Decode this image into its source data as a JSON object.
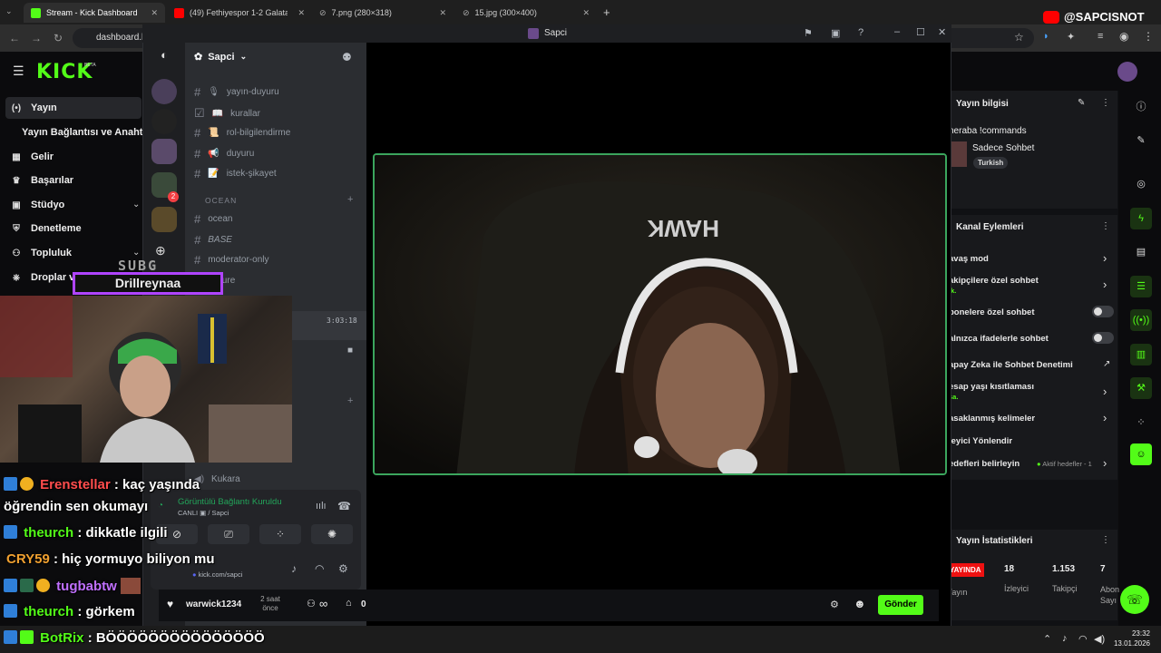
{
  "browser": {
    "tabs": [
      {
        "title": "Stream - Kick Dashboard",
        "icon": "kick-icon",
        "active": true
      },
      {
        "title": "(49) Fethiyespor 1-2 Galatasaray",
        "icon": "youtube-icon"
      },
      {
        "title": "7.png (280×318)",
        "icon": "globe-icon"
      },
      {
        "title": "15.jpg (300×400)",
        "icon": "globe-icon"
      }
    ],
    "url": "dashboard.ki",
    "new_tab": "+"
  },
  "watermark": "@SAPCISNOT",
  "kick": {
    "logo": "KICK",
    "beta": "BETA",
    "sidebar": [
      {
        "label": "Yayın",
        "icon": "broadcast-icon"
      },
      {
        "label": "Yayın Bağlantısı ve Anahta",
        "icon": ""
      },
      {
        "label": "Gelir",
        "icon": "chart-icon"
      },
      {
        "label": "Başarılar",
        "icon": "trophy-icon"
      },
      {
        "label": "Stüdyo",
        "icon": "video-icon"
      },
      {
        "label": "Denetleme",
        "icon": "shield-icon"
      },
      {
        "label": "Topluluk",
        "icon": "people-icon"
      },
      {
        "label": "Droplar ve ödüller",
        "icon": "gift-icon"
      }
    ],
    "stream_info": {
      "title": "Yayın bilgisi",
      "stream_title": "neraba !commands",
      "category": "Sadece Sohbet",
      "tag": "Turkish"
    },
    "channel_actions": {
      "title": "Kanal Eylemleri",
      "items": [
        {
          "label": "avaş mod",
          "control": "chevron"
        },
        {
          "label": "akipçilere özel sohbet",
          "sub": "ik.",
          "control": "chevron"
        },
        {
          "label": "bonelere özel sohbet",
          "control": "toggle"
        },
        {
          "label": "alnızca ifadelerle sohbet",
          "control": "toggle"
        },
        {
          "label": "apay Zeka ile Sohbet Denetimi",
          "control": "external"
        },
        {
          "label": "esap yaşı kısıtlaması",
          "sub": "sa.",
          "control": "chevron"
        },
        {
          "label": "asaklanmış kelimeler",
          "control": "chevron"
        },
        {
          "label": "leyici Yönlendir",
          "control": ""
        },
        {
          "label": "edefleri belirleyin",
          "sub_right": "Aktif hedefler - 1",
          "control": "chevron"
        }
      ]
    },
    "stats": {
      "title": "Yayın İstatistikleri",
      "live_badge": "YAYINDA",
      "live_label": "Yayın",
      "viewers": "18",
      "viewers_label": "İzleyici",
      "followers": "1.153",
      "followers_label": "Takipçi",
      "subs": "7",
      "subs_label": "Abon Sayı"
    },
    "bottom": {
      "user": "warwick1234",
      "time": "2 saat önce",
      "infinity": "∞",
      "count": "0",
      "send": "Gönder"
    }
  },
  "discord": {
    "window_title": "Sapci",
    "server_name": "Sapci",
    "channels": [
      {
        "name": "yayın-duyuru",
        "emoji": "🎙"
      },
      {
        "name": "kurallar",
        "emoji": "📖"
      },
      {
        "name": "rol-bilgilendirme",
        "emoji": "📜"
      },
      {
        "name": "duyuru",
        "emoji": "📢"
      },
      {
        "name": "istek-şikayet",
        "emoji": "📝"
      }
    ],
    "category": "OCEAN",
    "category_channels": [
      "ocean",
      "BASE",
      "moderator-only",
      "picture"
    ],
    "voice_channel": "Kukara",
    "timer": "3:03:18",
    "voice": {
      "status": "Görüntülü Bağlantı Kuruldu",
      "sub": "CANLI",
      "channel": "/ Sapci",
      "stream_url": "kick.com/sapci"
    },
    "badge_count": "2"
  },
  "overlay": {
    "sub_goal": "SUBG",
    "subscriber": "Drillreynaa",
    "chat": [
      {
        "user": "Erenstellar",
        "color": "#ff4d4d",
        "msg": ": kaç yaşında"
      },
      {
        "user": "",
        "color": "#ffffff",
        "msg": "öğrendin sen okumayı"
      },
      {
        "user": "theurch",
        "color": "#53fc18",
        "msg": ": dikkatle ilgili"
      },
      {
        "user": "CRY59",
        "color": "#f0a030",
        "msg": ": hiç yormuyo biliyon mu"
      },
      {
        "user": "tugbabtw",
        "color": "#c070ff",
        "msg": ""
      },
      {
        "user": "theurch",
        "color": "#53fc18",
        "msg": ": görkem"
      },
      {
        "user": "BotRix",
        "color": "#53fc18",
        "msg": ": BÖÖÖÖÖÖÖÖÖÖÖÖÖÖÖ"
      }
    ]
  },
  "taskbar": {
    "time": "23:32",
    "date": "13.01.2026"
  }
}
